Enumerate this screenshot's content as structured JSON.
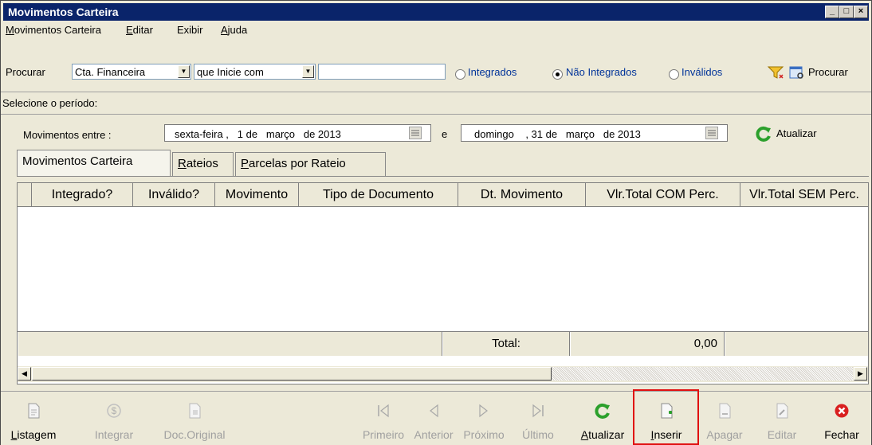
{
  "window": {
    "title": "Movimentos Carteira",
    "minimize_label": "_",
    "maximize_label": "□",
    "close_label": "×"
  },
  "menu": [
    {
      "label": "Movimentos Carteira"
    },
    {
      "label": "Editar"
    },
    {
      "label": "Exibir"
    },
    {
      "label": "Ajuda"
    }
  ],
  "search": {
    "procurar_label": "Procurar",
    "field_selected": "Cta. Financeira",
    "condition_selected": "que Inicie com",
    "value": "",
    "radios": [
      {
        "label": "Integrados",
        "checked": false
      },
      {
        "label": "Não Integrados",
        "checked": true
      },
      {
        "label": "Inválidos",
        "checked": false
      }
    ],
    "search_button": "Procurar"
  },
  "period": {
    "section_label": "Selecione o período:",
    "movimentos_entre_label": "Movimentos entre :",
    "start_date": "sexta-feira ,   1 de   março   de 2013",
    "conjunction": "e",
    "end_date": "domingo    , 31 de   março   de 2013",
    "refresh_label": "Atualizar"
  },
  "tabs": [
    {
      "label": "Movimentos Carteira",
      "active": true
    },
    {
      "label": "Rateios",
      "active": false
    },
    {
      "label": "Parcelas por Rateio",
      "active": false
    }
  ],
  "grid": {
    "columns": [
      "Integrado?",
      "Inválido?",
      "Movimento",
      "Tipo de Documento",
      "Dt. Movimento",
      "Vlr.Total COM Perc.",
      "Vlr.Total SEM Perc."
    ],
    "rows": [],
    "total_label": "Total:",
    "total_value": "0,00"
  },
  "toolbar": {
    "buttons": [
      {
        "label": "Listagem",
        "enabled": true
      },
      {
        "label": "Integrar",
        "enabled": false
      },
      {
        "label": "Doc.Original",
        "enabled": false
      },
      {
        "label": "Primeiro",
        "enabled": false
      },
      {
        "label": "Anterior",
        "enabled": false
      },
      {
        "label": "Próximo",
        "enabled": false
      },
      {
        "label": "Último",
        "enabled": false
      },
      {
        "label": "Atualizar",
        "enabled": true
      },
      {
        "label": "Inserir",
        "enabled": true,
        "highlighted": true
      },
      {
        "label": "Apagar",
        "enabled": false
      },
      {
        "label": "Editar",
        "enabled": false
      },
      {
        "label": "Fechar",
        "enabled": true
      }
    ]
  },
  "colors": {
    "title_bar": "#0a246a",
    "window_bg": "#ece9d8",
    "highlight_border": "#e01010",
    "refresh_green": "#2ca02c",
    "close_red": "#d92020",
    "radio_label_blue": "#003399"
  }
}
